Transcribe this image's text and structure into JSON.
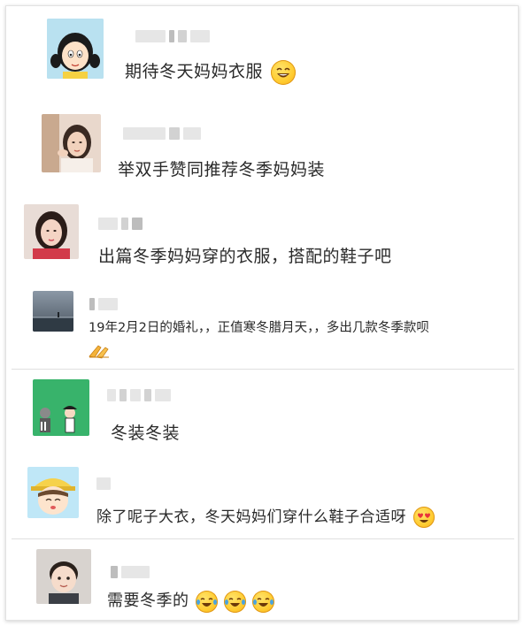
{
  "comments": [
    {
      "text": "期待冬天妈妈衣服",
      "emoji": "grinning-squint-face-icon"
    },
    {
      "text": "举双手赞同推荐冬季妈妈装"
    },
    {
      "text": "出篇冬季妈妈穿的衣服，搭配的鞋子吧"
    },
    {
      "text": "19年2月2日的婚礼，，正值寒冬腊月天，，多出几款冬季款呗",
      "emoji": "folded-hands-icon"
    },
    {
      "text": "冬装冬装"
    },
    {
      "text": "除了呢子大衣，冬天妈妈们穿什么鞋子合适呀",
      "emoji": "heart-eyes-face-icon"
    },
    {
      "text": "需要冬季的",
      "emoji": "laughing-tears-face-icon"
    }
  ],
  "colors": {
    "text": "#2a2a2a",
    "divider": "#e0e0e0",
    "emoji_yellow": "#ffcb2f"
  }
}
